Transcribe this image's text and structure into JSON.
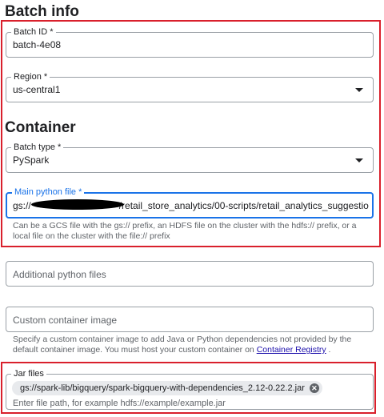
{
  "batch_info": {
    "heading": "Batch info",
    "batch_id": {
      "label": "Batch ID *",
      "value": "batch-4e08"
    },
    "region": {
      "label": "Region *",
      "value": "us-central1"
    }
  },
  "container": {
    "heading": "Container",
    "batch_type": {
      "label": "Batch type *",
      "value": "PySpark"
    },
    "main_python_file": {
      "label": "Main python file *",
      "value_prefix": "gs://",
      "value_suffix": "/retail_store_analytics/00-scripts/retail_analytics_suggestio",
      "hint": "Can be a GCS file with the gs:// prefix, an HDFS file on the cluster with the hdfs:// prefix, or a local file on the cluster with the file:// prefix"
    },
    "additional_python_files": {
      "placeholder": "Additional python files"
    },
    "custom_container_image": {
      "placeholder": "Custom container image",
      "hint_before_link": "Specify a custom container image to add Java or Python dependencies not provided by the default container image. You must host your custom container on ",
      "hint_link": "Container Registry",
      "hint_after_link": " ."
    },
    "jar_files": {
      "label": "Jar files",
      "chip": "gs://spark-lib/bigquery/spark-bigquery-with-dependencies_2.12-0.22.2.jar",
      "chip_remove_glyph": "✕",
      "placeholder": "Enter file path, for example hdfs://example/example.jar"
    }
  },
  "colors": {
    "highlight_border": "#d9202c",
    "focus_accent": "#1a73e8",
    "link": "#1a0dab"
  }
}
